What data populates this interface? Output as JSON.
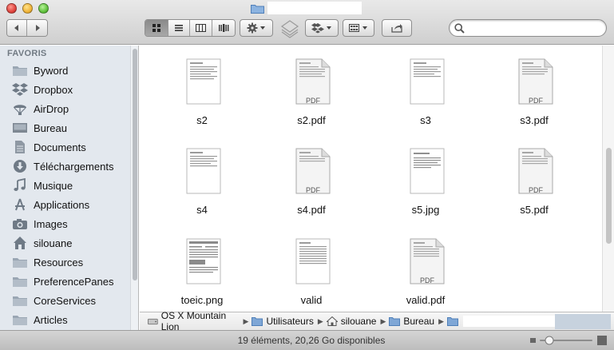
{
  "sidebar": {
    "section_title": "FAVORIS",
    "items": [
      {
        "label": "Byword",
        "icon": "folder-icon"
      },
      {
        "label": "Dropbox",
        "icon": "dropbox-icon"
      },
      {
        "label": "AirDrop",
        "icon": "airdrop-icon"
      },
      {
        "label": "Bureau",
        "icon": "desktop-icon"
      },
      {
        "label": "Documents",
        "icon": "documents-icon"
      },
      {
        "label": "Téléchargements",
        "icon": "downloads-icon"
      },
      {
        "label": "Musique",
        "icon": "music-icon"
      },
      {
        "label": "Applications",
        "icon": "applications-icon"
      },
      {
        "label": "Images",
        "icon": "camera-icon"
      },
      {
        "label": "silouane",
        "icon": "home-icon"
      },
      {
        "label": "Resources",
        "icon": "folder-icon"
      },
      {
        "label": "PreferencePanes",
        "icon": "folder-icon"
      },
      {
        "label": "CoreServices",
        "icon": "folder-icon"
      },
      {
        "label": "Articles",
        "icon": "folder-icon"
      }
    ]
  },
  "files": [
    {
      "name": "s2",
      "kind": "document"
    },
    {
      "name": "s2.pdf",
      "kind": "pdf",
      "badge": "PDF"
    },
    {
      "name": "s3",
      "kind": "document"
    },
    {
      "name": "s3.pdf",
      "kind": "pdf",
      "badge": "PDF"
    },
    {
      "name": "s4",
      "kind": "document"
    },
    {
      "name": "s4.pdf",
      "kind": "pdf",
      "badge": "PDF"
    },
    {
      "name": "s5.jpg",
      "kind": "image"
    },
    {
      "name": "s5.pdf",
      "kind": "pdf",
      "badge": "PDF"
    },
    {
      "name": "toeic.png",
      "kind": "image"
    },
    {
      "name": "valid",
      "kind": "document"
    },
    {
      "name": "valid.pdf",
      "kind": "pdf",
      "badge": "PDF"
    }
  ],
  "pathbar": {
    "crumbs": [
      "OS X Mountain Lion",
      "Utilisateurs",
      "silouane",
      "Bureau"
    ]
  },
  "status": {
    "text": "19 éléments, 20,26 Go disponibles"
  },
  "colors": {
    "sidebar_bg": "#e3e8ee",
    "sidebar_heading": "#717a83",
    "folder_blue": "#7fa7d6"
  }
}
